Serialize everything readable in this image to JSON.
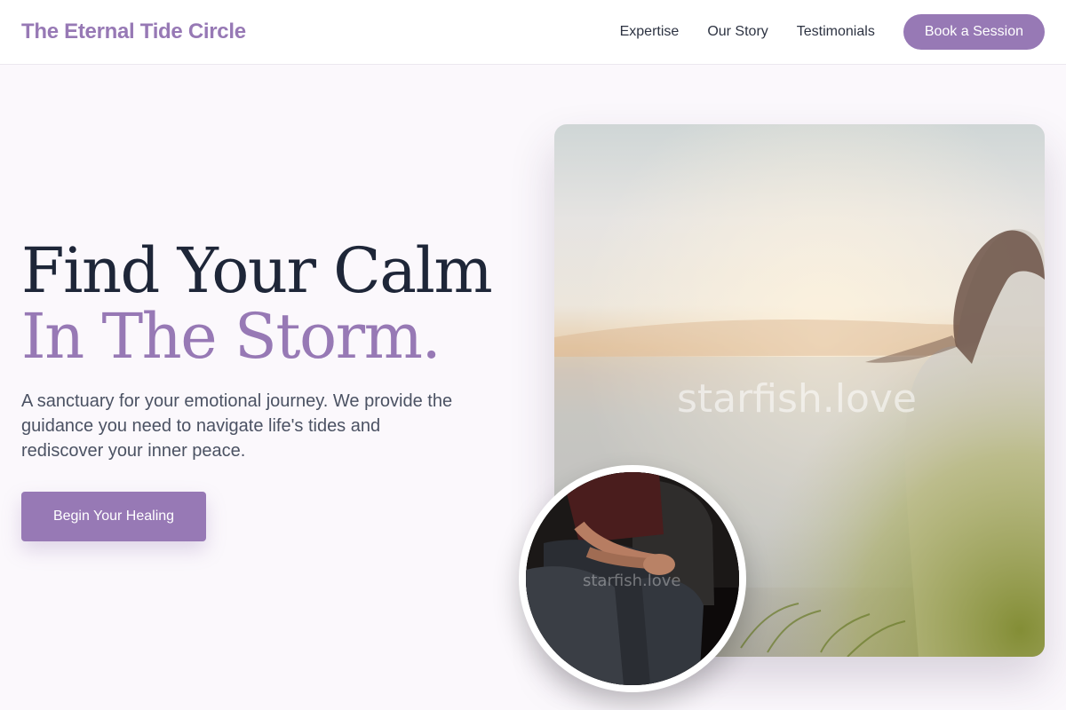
{
  "nav": {
    "brand": "The Eternal Tide Circle",
    "links": [
      "Expertise",
      "Our Story",
      "Testimonials"
    ],
    "cta": "Book a Session"
  },
  "hero": {
    "title_line_1": "Find Your Calm",
    "title_line_2": "In The Storm.",
    "subtitle": "A sanctuary for your emotional journey. We provide the guidance you need to navigate life's tides and rediscover your inner peace.",
    "cta": "Begin Your Healing"
  },
  "images": {
    "main_watermark": "starfish.love",
    "inset_watermark": "starfish.love"
  },
  "colors": {
    "accent": "#9779b5",
    "heading": "#1e2638",
    "body_text": "#4b5263",
    "background": "#fbf8fc"
  }
}
